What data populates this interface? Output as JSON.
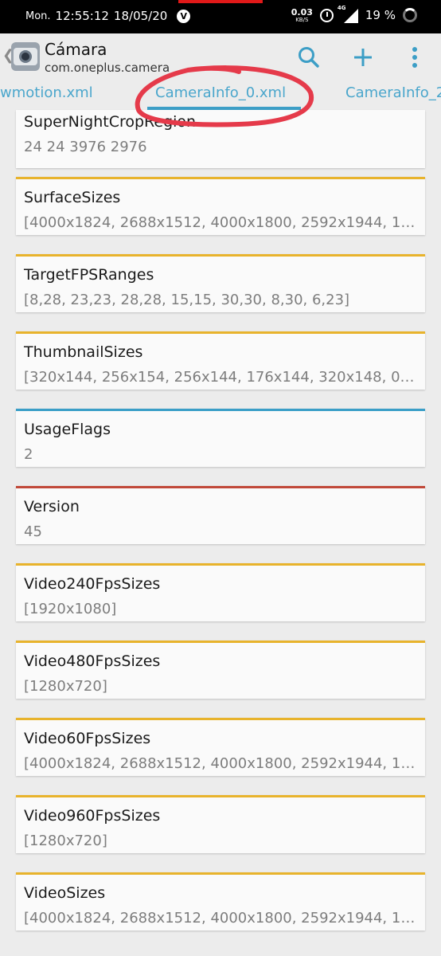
{
  "status_bar": {
    "day": "Mon.",
    "time": "12:55:12",
    "date": "18/05/20",
    "carrier_icon_letter": "V",
    "net_speed_value": "0.03",
    "net_speed_unit": "KB/S",
    "network_type": "4G",
    "battery_percent": "19 %"
  },
  "app_bar": {
    "title": "Cámara",
    "subtitle": "com.oneplus.camera",
    "back_glyph": "❮",
    "icons": [
      "search-icon",
      "plus-icon",
      "more-vert-icon"
    ],
    "accent_color": "#3c9ec6"
  },
  "tabs": [
    {
      "label": "wmotion.xml",
      "selected": false
    },
    {
      "label": "CameraInfo_0.xml",
      "selected": true
    },
    {
      "label": "CameraInfo_2",
      "selected": false
    }
  ],
  "entries": [
    {
      "name": "SuperNightCropRegion",
      "value": "24 24 3976 2976",
      "accent": "none"
    },
    {
      "name": "SurfaceSizes",
      "value": "[4000x1824, 2688x1512, 4000x1800, 2592x1944, 10…",
      "accent": "yellow"
    },
    {
      "name": "TargetFPSRanges",
      "value": "[8,28, 23,23, 28,28, 15,15, 30,30, 8,30, 6,23]",
      "accent": "yellow"
    },
    {
      "name": "ThumbnailSizes",
      "value": "[320x144, 256x154, 256x144, 176x144, 320x148, 0x…",
      "accent": "yellow"
    },
    {
      "name": "UsageFlags",
      "value": "2",
      "accent": "blue"
    },
    {
      "name": "Version",
      "value": "45",
      "accent": "red"
    },
    {
      "name": "Video240FpsSizes",
      "value": "[1920x1080]",
      "accent": "yellow"
    },
    {
      "name": "Video480FpsSizes",
      "value": "[1280x720]",
      "accent": "yellow"
    },
    {
      "name": "Video60FpsSizes",
      "value": "[4000x1824, 2688x1512, 4000x1800, 2592x1944, 10…",
      "accent": "yellow"
    },
    {
      "name": "Video960FpsSizes",
      "value": "[1280x720]",
      "accent": "yellow"
    },
    {
      "name": "VideoSizes",
      "value": "[4000x1824, 2688x1512, 4000x1800, 2592x1944, 10…",
      "accent": "yellow"
    }
  ],
  "accent_colors": {
    "yellow": "#e8b32c",
    "blue": "#3a9ec7",
    "red": "#c1493a"
  }
}
